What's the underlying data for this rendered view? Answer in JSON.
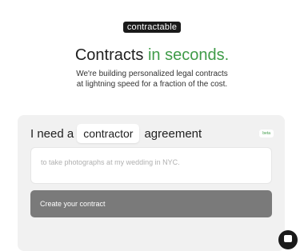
{
  "brand": {
    "logo_text": "contractable"
  },
  "hero": {
    "headline_lead": "Contracts",
    "headline_accent": "in seconds.",
    "subtitle_line1": "We're building personalized legal contracts",
    "subtitle_line2": "at lightning speed for a fraction of the cost."
  },
  "form": {
    "prefix": "I need a",
    "contract_type": "contractor",
    "suffix": "agreement",
    "badge": "beta",
    "purpose_placeholder": "to take photographs at my wedding in NYC.",
    "submit_label": "Create your contract"
  },
  "colors": {
    "accent_green": "#3f9b48",
    "button_gray": "#7a7a7a",
    "card_bg": "#f1f1f1"
  },
  "icons": {
    "chat": "chat-bubble-icon"
  }
}
